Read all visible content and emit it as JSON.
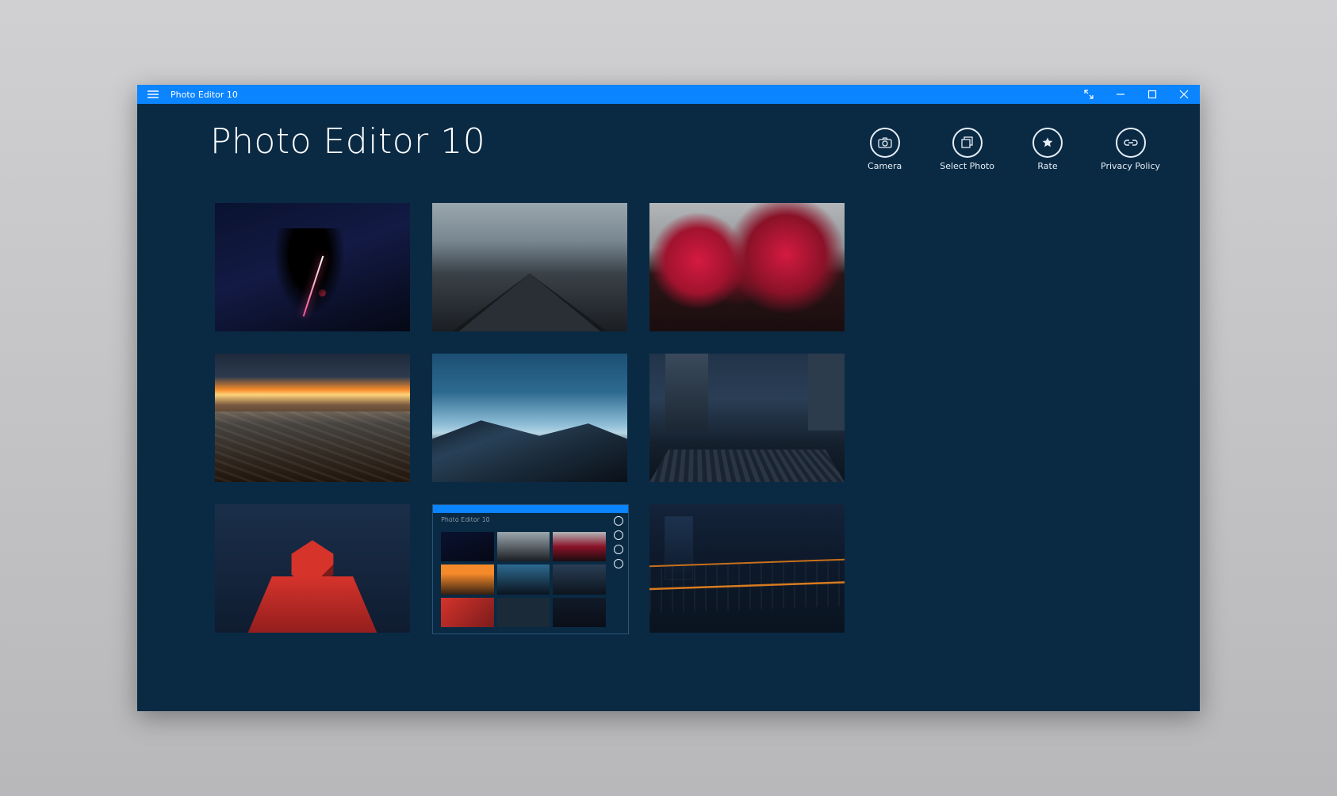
{
  "titlebar": {
    "app_name": "Photo Editor 10"
  },
  "header": {
    "title": "Photo Editor 10",
    "actions": {
      "camera": "Camera",
      "select_photo": "Select Photo",
      "rate": "Rate",
      "privacy": "Privacy Policy"
    }
  },
  "inner_preview": {
    "title": "Photo Editor 10"
  }
}
